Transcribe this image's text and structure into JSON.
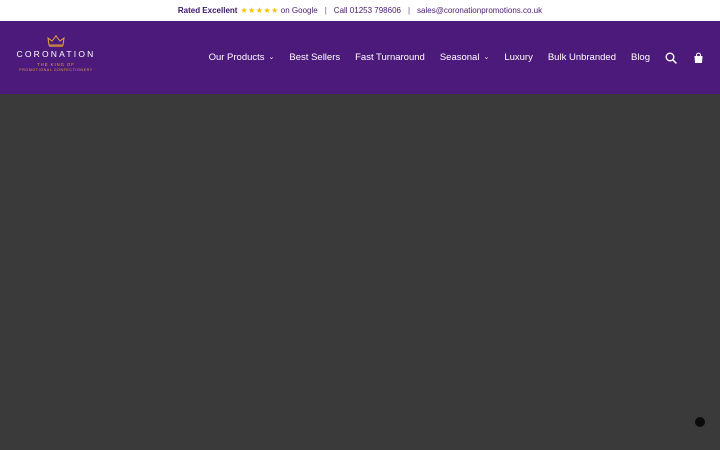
{
  "topbar": {
    "rated_label": "Rated Excellent",
    "stars": "★★★★★",
    "on_google": "on Google",
    "separator": "|",
    "phone": "Call 01253 798606",
    "email": "sales@coronationpromotions.co.uk"
  },
  "logo": {
    "brand": "CORONATION",
    "tagline_1": "THE KING OF",
    "tagline_2": "PROMOTIONAL CONFECTIONERY"
  },
  "nav": {
    "items": [
      {
        "label": "Our Products",
        "has_dropdown": true
      },
      {
        "label": "Best Sellers",
        "has_dropdown": false
      },
      {
        "label": "Fast Turnaround",
        "has_dropdown": false
      },
      {
        "label": "Seasonal",
        "has_dropdown": true
      },
      {
        "label": "Luxury",
        "has_dropdown": false
      },
      {
        "label": "Bulk Unbranded",
        "has_dropdown": false
      },
      {
        "label": "Blog",
        "has_dropdown": false
      }
    ],
    "chevron": "⌄",
    "icons": [
      "search-icon",
      "shopping-bag-icon"
    ]
  },
  "colors": {
    "header_bg": "#4c1a7a",
    "accent_gold": "#e8a33a",
    "stars": "#f2c200",
    "main_bg": "#3a3a3a"
  }
}
